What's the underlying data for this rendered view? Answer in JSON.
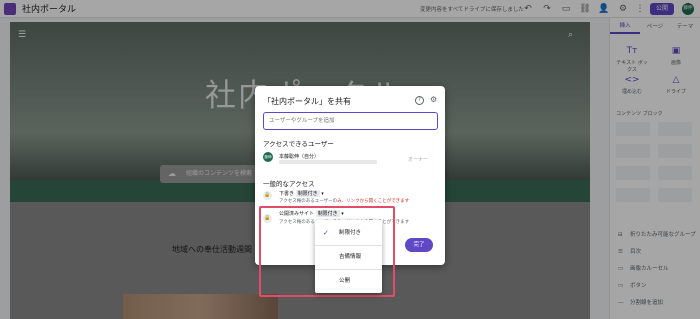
{
  "app": {
    "title": "社内ポータル",
    "draft_note": "変更内容をすべてドライブに保存しました",
    "publish_label": "公開",
    "avatar_initials": "藤伸"
  },
  "canvas": {
    "hero_title": "社内ポータル",
    "search_placeholder": "組織のコンテンツを検索",
    "section_title": "地域への奉仕活動週間"
  },
  "sidepanel": {
    "tabs": [
      "挿入",
      "ページ",
      "テーマ"
    ],
    "insert_items": [
      {
        "label": "テキスト ボックス",
        "icon": "text-icon"
      },
      {
        "label": "画像",
        "icon": "image-icon"
      },
      {
        "label": "埋め込む",
        "icon": "embed-icon"
      },
      {
        "label": "ドライブ",
        "icon": "drive-icon"
      }
    ],
    "content_blocks_label": "コンテンツ ブロック",
    "items": [
      {
        "label": "折りたたみ可能なグループ",
        "icon": "collapse-icon"
      },
      {
        "label": "目次",
        "icon": "toc-icon"
      },
      {
        "label": "画像カルーセル",
        "icon": "carousel-icon"
      },
      {
        "label": "ボタン",
        "icon": "button-icon"
      },
      {
        "label": "分割線を追加",
        "icon": "divider-icon"
      }
    ]
  },
  "dialog": {
    "title": "「社内ポータル」を共有",
    "add_placeholder": "ユーザーやグループを追加",
    "access_label": "アクセスできるユーザー",
    "owner_initials": "藤伸",
    "owner_name": "本藤聡伸（自分）",
    "owner_role": "オーナー",
    "general_access_label": "一般的なアクセス",
    "draft_row": {
      "title": "下書き",
      "select": "制限付き",
      "sub_prefix": "アクセス権のあるユーザーの",
      "sub_link": "み、リンクから開くことができます"
    },
    "published_row": {
      "title": "公開済みサイト",
      "select": "制限付き",
      "sub": "アクセス権のあるユーザーのみ、リンクから開くことができます"
    },
    "done_label": "完了"
  },
  "menu": {
    "items": [
      {
        "label": "制限付き",
        "checked": true
      },
      {
        "label": "吉備情報",
        "checked": false
      },
      {
        "label": "公開",
        "checked": false
      }
    ]
  },
  "colors": {
    "accent": "#5f48c6",
    "highlight": "#e04d6a",
    "avatar": "#1e6b52"
  }
}
